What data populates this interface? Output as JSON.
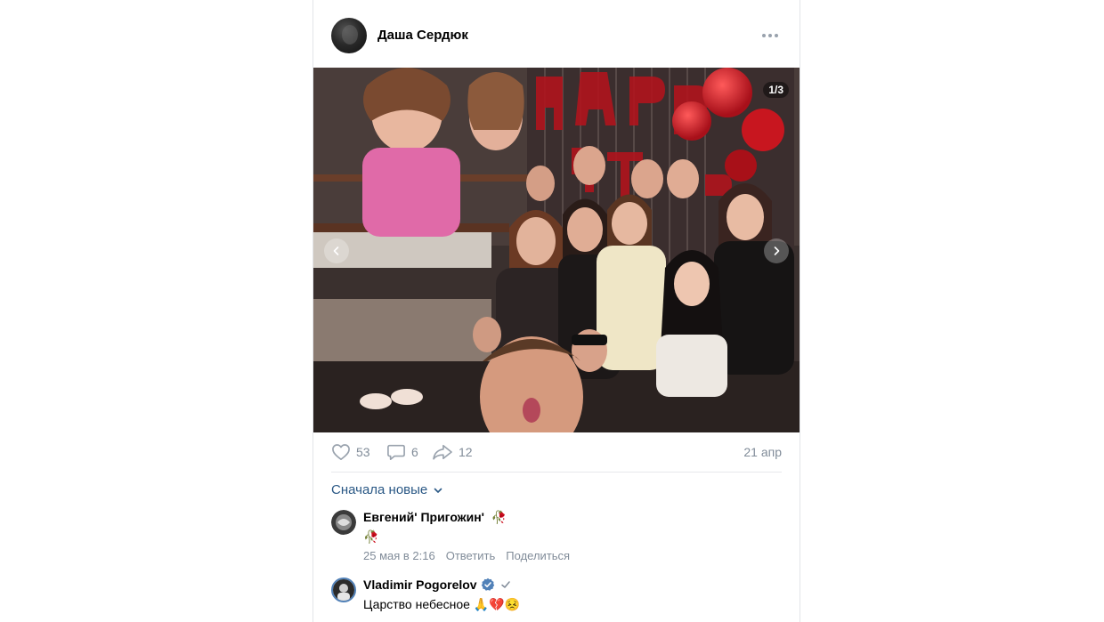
{
  "post": {
    "author": "Даша Сердюк",
    "photo_counter": "1/3",
    "likes": "53",
    "comments": "6",
    "shares": "12",
    "date": "21 апр"
  },
  "comments_sort": "Сначала новые",
  "comments": [
    {
      "name": "Евгений' Пригожин'",
      "name_badge": "🥀",
      "text": "🥀",
      "time": "25 мая в 2:16",
      "reply": "Ответить",
      "share": "Поделиться"
    },
    {
      "name": "Vladimir Pogorelov",
      "text": "Царство небесное 🙏💔😣"
    }
  ],
  "colors": {
    "link": "#2a5885",
    "muted": "#818c99",
    "verified": "#5181b8"
  }
}
